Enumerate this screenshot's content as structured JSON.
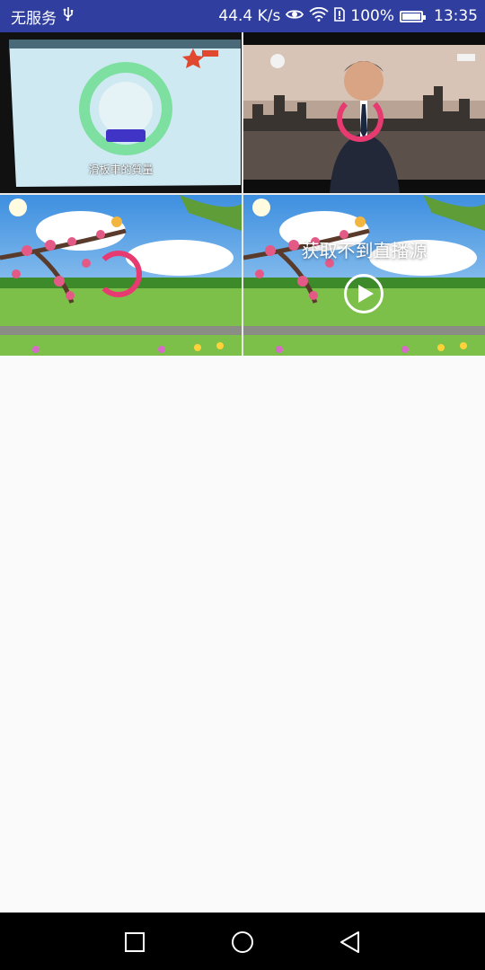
{
  "status_bar": {
    "carrier": "无服务",
    "usb_icon": "usb-icon",
    "net_speed": "44.4 K/s",
    "eye_icon": "eye-icon",
    "wifi_icon": "wifi-icon",
    "sim_icon": "sim-icon",
    "battery_percent": "100%",
    "battery_icon": "battery-charging-icon",
    "time": "13:35"
  },
  "tiles": [
    {
      "caption": "滑板車的質量",
      "state": "playing"
    },
    {
      "state": "loading"
    },
    {
      "state": "loading"
    },
    {
      "error_text": "获取不到直播源",
      "action_icon": "play-icon"
    }
  ],
  "nav_bar": {
    "recents_icon": "square-recents-icon",
    "home_icon": "circle-home-icon",
    "back_icon": "triangle-back-icon"
  },
  "colors": {
    "status_bar": "#303f9f",
    "spinner": "#e63a71",
    "background": "#fafafa"
  }
}
